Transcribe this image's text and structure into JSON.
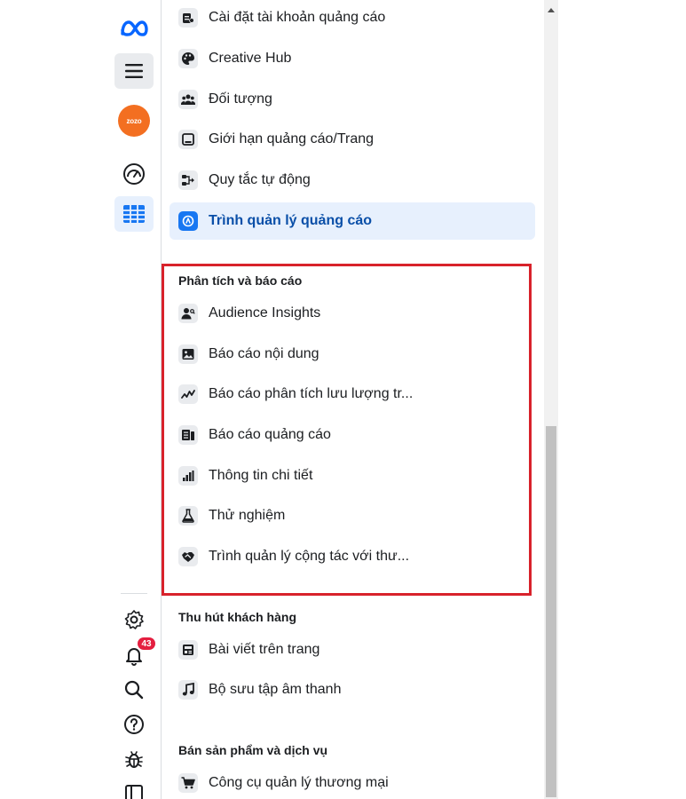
{
  "rail": {
    "avatar_text": "zozo",
    "notification_count": "43"
  },
  "menu": {
    "top_items": [
      {
        "label": "Cài đặt tài khoản quảng cáo",
        "icon": "ad-account-settings-icon"
      },
      {
        "label": "Creative Hub",
        "icon": "palette-icon"
      },
      {
        "label": "Đối tượng",
        "icon": "audience-icon"
      },
      {
        "label": "Giới hạn quảng cáo/Trang",
        "icon": "ad-limit-icon"
      },
      {
        "label": "Quy tắc tự động",
        "icon": "automated-rules-icon"
      },
      {
        "label": "Trình quản lý quảng cáo",
        "icon": "ads-manager-icon",
        "active": true
      }
    ],
    "analytics_section": {
      "title": "Phân tích và báo cáo",
      "items": [
        {
          "label": "Audience Insights",
          "icon": "audience-insights-icon"
        },
        {
          "label": "Báo cáo nội dung",
          "icon": "image-icon"
        },
        {
          "label": "Báo cáo phân tích lưu lượng tr...",
          "icon": "trend-line-icon"
        },
        {
          "label": "Báo cáo quảng cáo",
          "icon": "report-icon"
        },
        {
          "label": "Thông tin chi tiết",
          "icon": "bar-chart-icon"
        },
        {
          "label": "Thử nghiệm",
          "icon": "flask-icon"
        },
        {
          "label": "Trình quản lý cộng tác với thư...",
          "icon": "handshake-icon"
        }
      ]
    },
    "engage_section": {
      "title": "Thu hút khách hàng",
      "items": [
        {
          "label": "Bài viết trên trang",
          "icon": "page-posts-icon"
        },
        {
          "label": "Bộ sưu tập âm thanh",
          "icon": "music-note-icon"
        }
      ]
    },
    "sell_section": {
      "title": "Bán sản phẩm và dịch vụ",
      "items": [
        {
          "label": "Công cụ quản lý thương mại",
          "icon": "shopping-cart-icon"
        }
      ]
    }
  },
  "colors": {
    "accent": "#1877f2",
    "active_bg": "#e7f0fd",
    "highlight_border": "#d8222b",
    "badge": "#e41e3f",
    "brand_avatar": "#f36f21"
  }
}
